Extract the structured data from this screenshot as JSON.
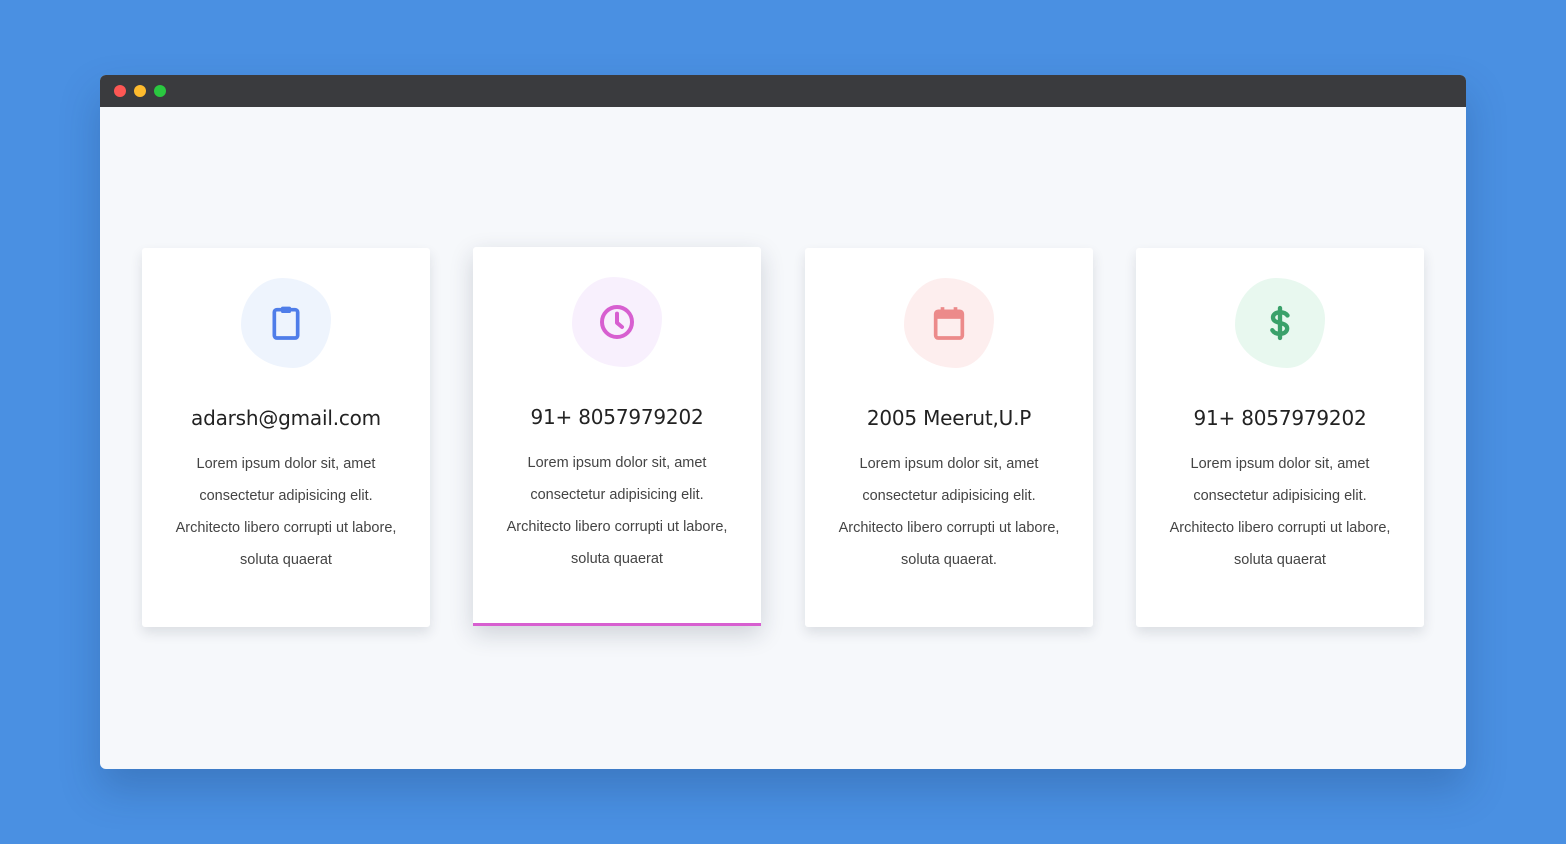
{
  "window": {
    "controls": [
      "close",
      "minimize",
      "maximize"
    ]
  },
  "cards": [
    {
      "icon": "clipboard-icon",
      "icon_color": "#4f7de9",
      "icon_bg": "#eef4fd",
      "title": "adarsh@gmail.com",
      "text": "Lorem ipsum dolor sit, amet consectetur adipisicing elit. Architecto libero corrupti ut labore, soluta quaerat"
    },
    {
      "icon": "clock-icon",
      "icon_color": "#d75fd0",
      "icon_bg": "#f8f0fd",
      "title": "91+ 8057979202",
      "text": "Lorem ipsum dolor sit, amet consectetur adipisicing elit. Architecto libero corrupti ut labore, soluta quaerat",
      "active": true,
      "accent": "#d75fd0"
    },
    {
      "icon": "calendar-icon",
      "icon_color": "#ec8a8a",
      "icon_bg": "#fdeeee",
      "title": "2005 Meerut,U.P",
      "text": "Lorem ipsum dolor sit, amet consectetur adipisicing elit. Architecto libero corrupti ut labore, soluta quaerat."
    },
    {
      "icon": "dollar-icon",
      "icon_color": "#3aa16a",
      "icon_bg": "#e8f8ef",
      "title": "91+ 8057979202",
      "text": "Lorem ipsum dolor sit, amet consectetur adipisicing elit. Architecto libero corrupti ut labore, soluta quaerat"
    }
  ]
}
